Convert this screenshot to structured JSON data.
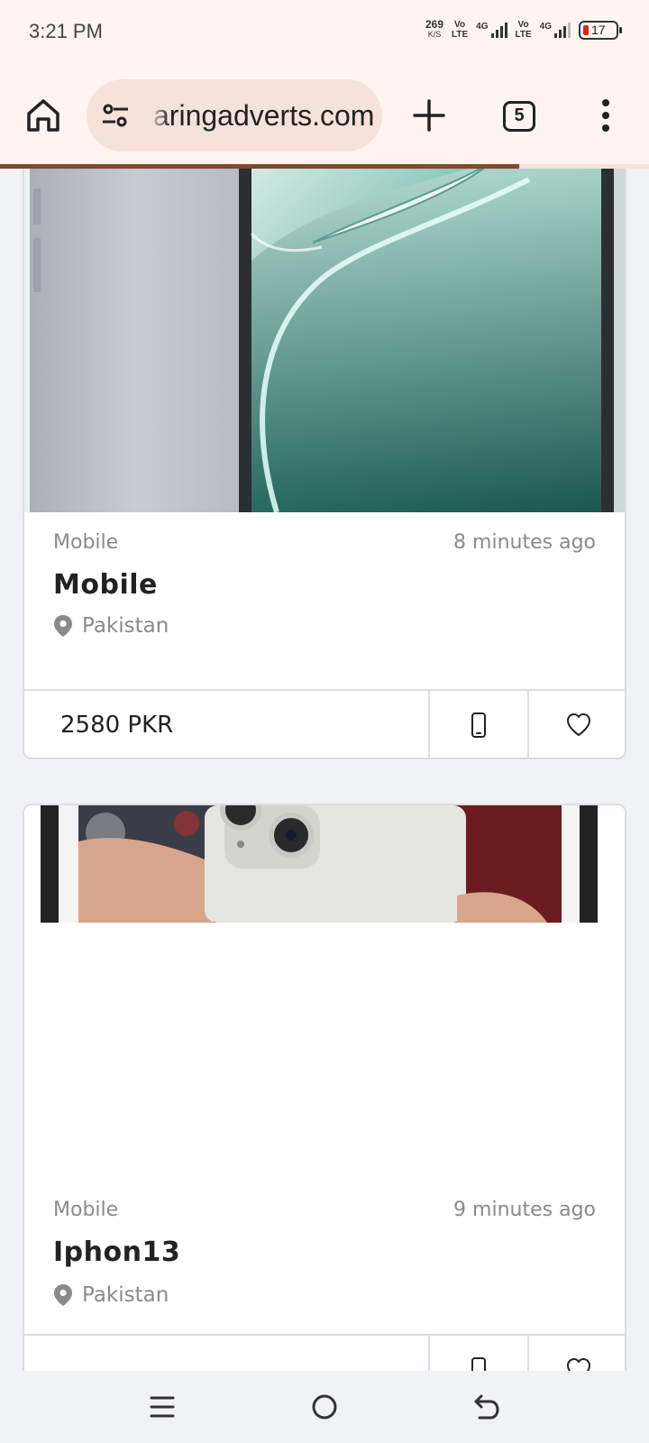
{
  "status_bar": {
    "time": "3:21 PM",
    "net_speed_value": "269",
    "net_speed_unit": "K/S",
    "volte1_top": "Vo",
    "volte1_bottom": "LTE",
    "sig1_label": "4G",
    "volte2_top": "Vo",
    "volte2_bottom": "LTE",
    "sig2_label": "4G",
    "battery_level": "17"
  },
  "browser": {
    "url": "aringadverts.com",
    "tab_count": "5",
    "load_progress": 0.8,
    "icons": {
      "home": "home-icon",
      "site_info": "tune-icon",
      "new_tab": "plus-icon",
      "menu": "more-vert-icon"
    }
  },
  "listings": [
    {
      "category": "Mobile",
      "time_ago": "8 minutes ago",
      "title": "Mobile",
      "location": "Pakistan",
      "price": "2580 PKR"
    },
    {
      "category": "Mobile",
      "time_ago": "9 minutes ago",
      "title": "Iphon13",
      "location": "Pakistan"
    }
  ],
  "colors": {
    "toolbar_bg": "#fff4f0",
    "url_pill_bg": "#f5e2da",
    "progress": "#7d4a2e",
    "page_bg": "#f1f2f6"
  }
}
